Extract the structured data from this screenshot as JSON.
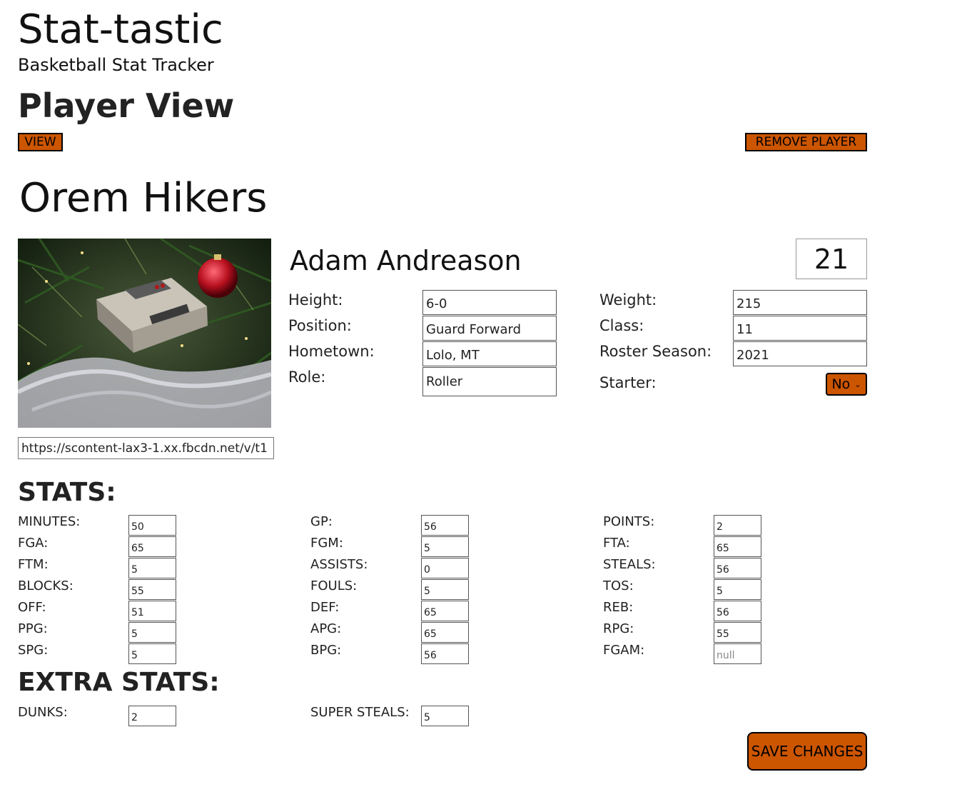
{
  "app": {
    "title": "Stat-tastic",
    "subtitle": "Basketball Stat Tracker"
  },
  "page": {
    "title": "Player View",
    "view_button": "VIEW",
    "remove_button": "REMOVE PLAYER",
    "accent_color": "#cc5500"
  },
  "team": {
    "name": "Orem Hikers"
  },
  "player": {
    "name": "Adam Andreason",
    "number": "21",
    "photo_url": "https://scontent-lax3-1.xx.fbcdn.net/v/t1",
    "fields": {
      "height_label": "Height:",
      "height": "6-0",
      "position_label": "Position:",
      "position": "Guard Forward",
      "hometown_label": "Hometown:",
      "hometown": "Lolo, MT",
      "role_label": "Role:",
      "role": "Roller",
      "weight_label": "Weight:",
      "weight": "215",
      "class_label": "Class:",
      "class": "11",
      "roster_season_label": "Roster Season:",
      "roster_season": "2021",
      "starter_label": "Starter:",
      "starter": "No"
    }
  },
  "stats": {
    "title": "STATS:",
    "items": [
      {
        "label": "MINUTES:",
        "value": "50"
      },
      {
        "label": "GP:",
        "value": "56"
      },
      {
        "label": "POINTS:",
        "value": "2"
      },
      {
        "label": "FGA:",
        "value": "65"
      },
      {
        "label": "FGM:",
        "value": "5"
      },
      {
        "label": "FTA:",
        "value": "65"
      },
      {
        "label": "FTM:",
        "value": "5"
      },
      {
        "label": "ASSISTS:",
        "value": "0"
      },
      {
        "label": "STEALS:",
        "value": "56"
      },
      {
        "label": "BLOCKS:",
        "value": "55"
      },
      {
        "label": "FOULS:",
        "value": "5"
      },
      {
        "label": "TOS:",
        "value": "5"
      },
      {
        "label": "OFF:",
        "value": "51"
      },
      {
        "label": "DEF:",
        "value": "65"
      },
      {
        "label": "REB:",
        "value": "56"
      },
      {
        "label": "PPG:",
        "value": "5"
      },
      {
        "label": "APG:",
        "value": "65"
      },
      {
        "label": "RPG:",
        "value": "55"
      },
      {
        "label": "SPG:",
        "value": "5"
      },
      {
        "label": "BPG:",
        "value": "56"
      },
      {
        "label": "FGAM:",
        "value": "",
        "placeholder": "null"
      }
    ]
  },
  "extra_stats": {
    "title": "EXTRA STATS:",
    "items": [
      {
        "label": "DUNKS:",
        "value": "2"
      },
      {
        "label": "SUPER STEALS:",
        "value": "5"
      }
    ]
  },
  "save_button": "SAVE CHANGES"
}
